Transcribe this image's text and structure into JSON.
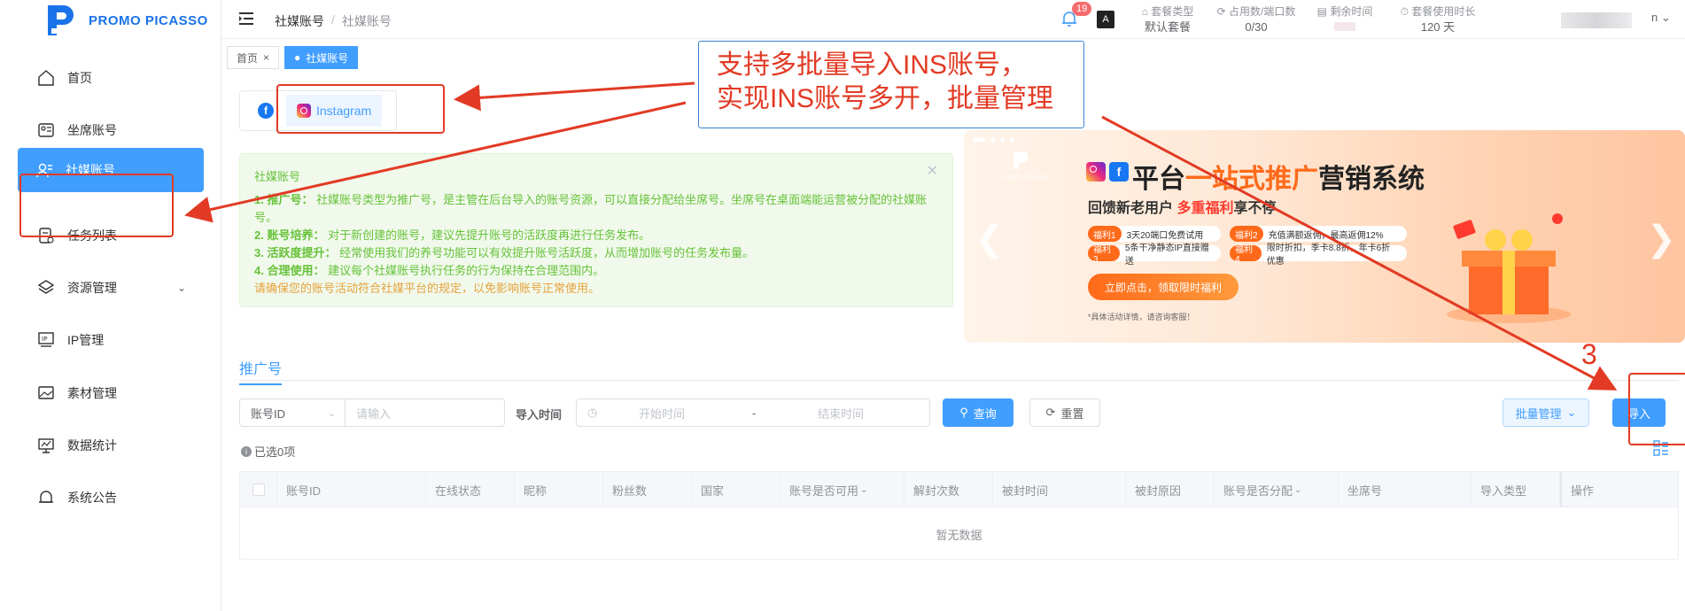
{
  "brand": {
    "name": "PROMO PICASSO",
    "accent": "#409eff",
    "annotation_color": "#e23a24"
  },
  "sidebar": {
    "items": [
      {
        "label": "首页",
        "icon": "home-icon"
      },
      {
        "label": "坐席账号",
        "icon": "seat-icon"
      },
      {
        "label": "社媒账号",
        "icon": "user-list-icon",
        "active": true
      },
      {
        "label": "任务列表",
        "icon": "task-icon"
      },
      {
        "label": "资源管理",
        "icon": "layers-icon",
        "expandable": true
      },
      {
        "label": "IP管理",
        "icon": "ip-icon"
      },
      {
        "label": "素材管理",
        "icon": "image-icon"
      },
      {
        "label": "数据统计",
        "icon": "chart-icon"
      },
      {
        "label": "系统公告",
        "icon": "bell-icon"
      }
    ]
  },
  "header": {
    "breadcrumb": [
      "社媒账号",
      "社媒账号"
    ],
    "notification_count": "19",
    "stats": [
      {
        "label": "套餐类型",
        "value": "默认套餐"
      },
      {
        "label": "占用数/端口数",
        "value": "0/30"
      },
      {
        "label": "剩余时间",
        "value": ""
      },
      {
        "label": "套餐使用时长",
        "value": "120 天"
      }
    ],
    "user_suffix": "n"
  },
  "tags": [
    {
      "label": "首页",
      "closable": true
    },
    {
      "label": "社媒账号",
      "active": true
    }
  ],
  "platforms": {
    "facebook": "f",
    "instagram": "Instagram"
  },
  "notice": {
    "title": "社媒账号",
    "items": [
      {
        "head": "1. 推广号：",
        "text": "社媒账号类型为推广号，是主管在后台导入的账号资源，可以直接分配给坐席号。坐席号在桌面端能运营被分配的社媒账号。"
      },
      {
        "head": "2. 账号培养：",
        "text": "对于新创建的账号，建议先提升账号的活跃度再进行任务发布。"
      },
      {
        "head": "3. 活跃度提升：",
        "text": "经常使用我们的养号功能可以有效提升账号活跃度，从而增加账号的任务发布量。"
      },
      {
        "head": "4. 合理使用：",
        "text": "建议每个社媒账号执行任务的行为保持在合理范围内。"
      }
    ],
    "warning": "请确保您的账号活动符合社媒平台的规定，以免影响账号正常使用。"
  },
  "banner": {
    "title_a": "平台",
    "title_hl": "一站式推广",
    "title_b": "营销系统",
    "sub_a": "回馈新老用户",
    "sub_hl": "多重福利",
    "sub_b": "享不停",
    "perks": [
      {
        "tag": "福利1",
        "text": "3天20端口免费试用"
      },
      {
        "tag": "福利2",
        "text": "充值满额返佣，最高返佣12%"
      },
      {
        "tag": "福利3",
        "text": "5条干净静态IP直接赠送"
      },
      {
        "tag": "福利4",
        "text": "限时折扣，季卡8.8折，年卡6折优惠"
      }
    ],
    "cta": "立即点击，领取限时福利",
    "fine_print": "*具体活动详情，请咨询客服！",
    "logo_text": "PROMO PICASSO"
  },
  "section_tab": "推广号",
  "filters": {
    "field_select": "账号ID",
    "input_placeholder": "请输入",
    "time_label": "导入时间",
    "start_placeholder": "开始时间",
    "range_sep": "-",
    "end_placeholder": "结束时间",
    "query": "查询",
    "reset": "重置",
    "batch": "批量管理",
    "import": "导入"
  },
  "selection": "已选0项",
  "table": {
    "columns": [
      "账号ID",
      "在线状态",
      "昵称",
      "粉丝数",
      "国家",
      "账号是否可用",
      "解封次数",
      "被封时间",
      "被封原因",
      "账号是否分配",
      "坐席号",
      "导入类型",
      "操作"
    ],
    "empty": "暂无数据"
  },
  "annotations": {
    "callout_line1": "支持多批量导入INS账号，",
    "callout_line2": "实现INS账号多开，批量管理",
    "step_number": "3"
  }
}
